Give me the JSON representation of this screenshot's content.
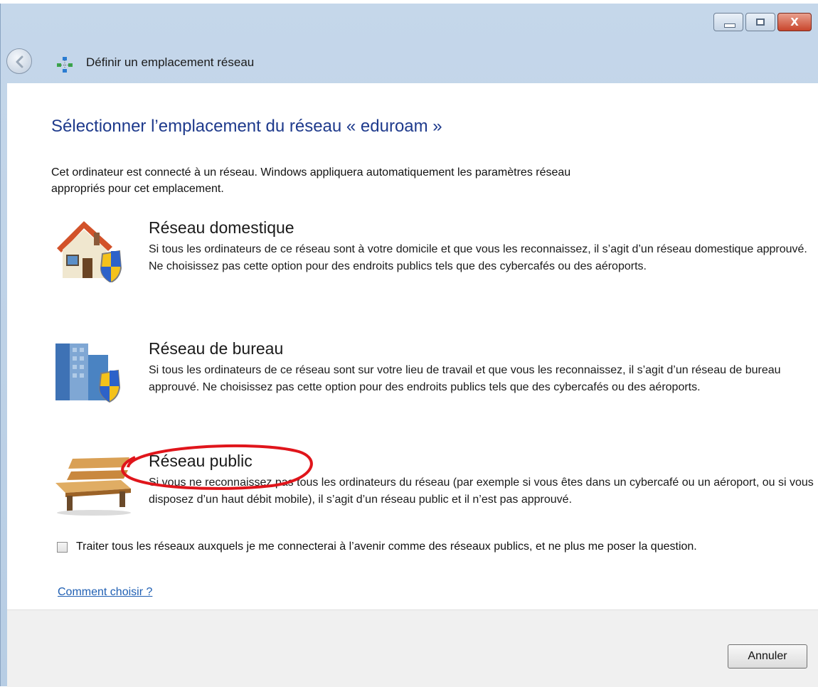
{
  "window": {
    "title": "Définir un emplacement réseau"
  },
  "caption_buttons": {
    "close_glyph": "X"
  },
  "main": {
    "heading": "Sélectionner l’emplacement du réseau « eduroam »",
    "intro": "Cet ordinateur est connecté à un réseau. Windows appliquera automatiquement les paramètres réseau appropriés pour cet emplacement.",
    "options": [
      {
        "title": "Réseau domestique",
        "description": "Si tous les ordinateurs de ce réseau sont à votre domicile et que vous les reconnaissez, il s’agit d’un réseau domestique approuvé. Ne choisissez pas cette option pour des endroits publics tels que des cybercafés ou des aéroports.",
        "icon": "house-shield-icon"
      },
      {
        "title": "Réseau de bureau",
        "description": "Si tous les ordinateurs de ce réseau sont sur votre lieu de travail et que vous les reconnaissez, il s’agit d’un réseau de bureau approuvé. Ne choisissez pas cette option pour des endroits publics tels que des cybercafés ou des aéroports.",
        "icon": "office-building-shield-icon"
      },
      {
        "title": "Réseau public",
        "description": "Si vous ne reconnaissez pas tous les ordinateurs du réseau (par exemple si vous êtes dans un cybercafé ou un aéroport, ou si vous disposez d’un haut débit mobile), il s’agit d’un réseau public et il n’est pas approuvé.",
        "icon": "park-bench-icon",
        "highlighted": true
      }
    ],
    "checkbox": {
      "label": "Traiter tous les réseaux auxquels je me connecterai à l’avenir comme des réseaux publics, et ne plus me poser la question.",
      "checked": false
    },
    "help_link": "Comment choisir ?"
  },
  "footer": {
    "cancel_label": "Annuler"
  },
  "colors": {
    "heading": "#1e3a8c",
    "link": "#1f5fb3",
    "annotation": "#e0151b"
  }
}
